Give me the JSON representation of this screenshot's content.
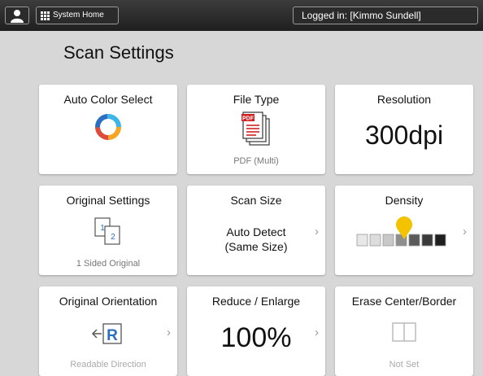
{
  "topbar": {
    "home_label": "System Home",
    "login_text": "Logged in: [Kimmo Sundell]"
  },
  "page": {
    "title": "Scan Settings"
  },
  "tiles": {
    "auto_color": {
      "title": "Auto Color Select"
    },
    "file_type": {
      "title": "File Type",
      "value": "PDF (Multi)",
      "icon_text": "PDF"
    },
    "resolution": {
      "title": "Resolution",
      "value": "300dpi"
    },
    "original_settings": {
      "title": "Original Settings",
      "value": "1 Sided Original",
      "page1": "1",
      "page2": "2"
    },
    "scan_size": {
      "title": "Scan Size",
      "value_line1": "Auto Detect",
      "value_line2": "(Same Size)"
    },
    "density": {
      "title": "Density",
      "level": 4,
      "levels": 7
    },
    "orientation": {
      "title": "Original Orientation",
      "value": "Readable Direction",
      "icon_letter": "R"
    },
    "reduce_enlarge": {
      "title": "Reduce / Enlarge",
      "value": "100%"
    },
    "erase": {
      "title": "Erase Center/Border",
      "value": "Not Set"
    }
  },
  "colors": {
    "accent_blue": "#2a6fc1",
    "pdf_red": "#d32020",
    "density_thumb": "#f3c300"
  }
}
